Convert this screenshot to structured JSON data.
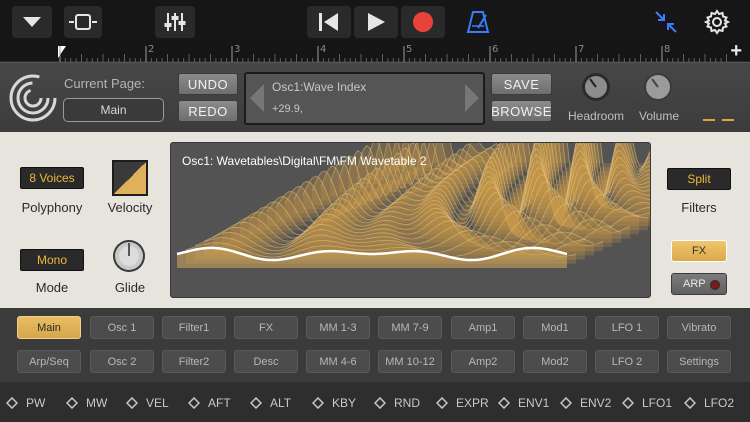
{
  "topbar": {
    "icons": [
      "dropdown-arrow-icon",
      "view-toggle-icon",
      "mixer-sliders-icon",
      "skip-to-start-icon",
      "play-icon",
      "record-icon",
      "metronome-icon",
      "collapse-arrows-icon",
      "settings-gear-icon"
    ],
    "accent": "#3a7bff",
    "record_color": "#e8433a"
  },
  "ruler": {
    "marks": [
      "2",
      "3",
      "4",
      "5",
      "6",
      "7",
      "8"
    ],
    "add_label": "+"
  },
  "header": {
    "current_page_label": "Current Page:",
    "current_page_value": "Main",
    "undo": "UNDO",
    "redo": "REDO",
    "param_name": "Osc1:Wave Index",
    "param_value": "+29.9,",
    "save": "SAVE",
    "browse": "BROWSE",
    "headroom": "Headroom",
    "volume": "Volume"
  },
  "synth": {
    "polyphony_value": "8 Voices",
    "polyphony_label": "Polyphony",
    "velocity_label": "Velocity",
    "mode_value": "Mono",
    "mode_label": "Mode",
    "glide_label": "Glide",
    "wavetable_title": "Osc1: Wavetables\\Digital\\FM\\FM Wavetable 2",
    "filters_value": "Split",
    "filters_label": "Filters",
    "fx_label": "FX",
    "arp_label": "ARP",
    "accent": "#f0b83a"
  },
  "pages": {
    "row1": [
      "Main",
      "Osc 1",
      "Filter1",
      "FX",
      "MM 1-3",
      "MM 7-9",
      "Amp1",
      "Mod1",
      "LFO 1",
      "Vibrato"
    ],
    "row2": [
      "Arp/Seq",
      "Osc 2",
      "Filter2",
      "Desc",
      "MM 4-6",
      "MM 10-12",
      "Amp2",
      "Mod2",
      "LFO 2",
      "Settings"
    ],
    "active": "Main"
  },
  "mod_sources": [
    "PW",
    "MW",
    "VEL",
    "AFT",
    "ALT",
    "KBY",
    "RND",
    "EXPR",
    "ENV1",
    "ENV2",
    "LFO1",
    "LFO2"
  ]
}
